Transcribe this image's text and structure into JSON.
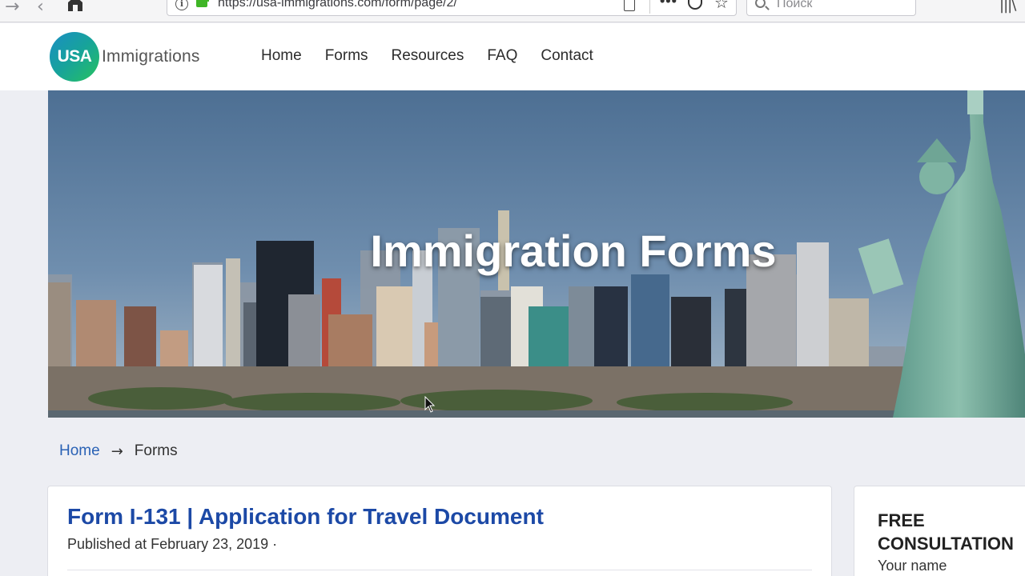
{
  "browser": {
    "url": "https://usa-immigrations.com/form/page/2/",
    "search_placeholder": "Поиск"
  },
  "site": {
    "logo_badge": "USA",
    "logo_text": "Immigrations",
    "nav": [
      "Home",
      "Forms",
      "Resources",
      "FAQ",
      "Contact"
    ]
  },
  "hero": {
    "title": "Immigration Forms"
  },
  "breadcrumb": {
    "home": "Home",
    "separator": "→",
    "current": "Forms"
  },
  "article": {
    "title": "Form I-131 | Application for Travel Document",
    "meta": "Published at February 23, 2019 ·"
  },
  "sidebar": {
    "widget_title": "FREE CONSULTATION",
    "name_label": "Your name"
  },
  "colors": {
    "link": "#2a62b5",
    "title": "#1c49a6",
    "page_bg": "#edeef3"
  }
}
